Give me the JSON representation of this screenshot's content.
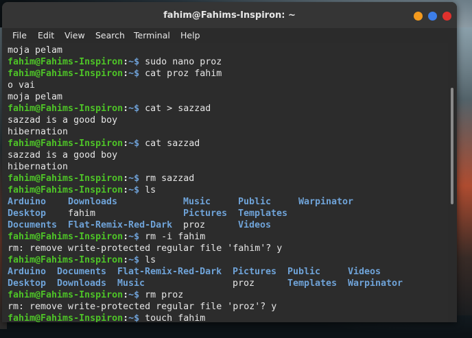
{
  "window": {
    "title": "fahim@Fahims-Inspiron: ~"
  },
  "menu": {
    "file": "File",
    "edit": "Edit",
    "view": "View",
    "search": "Search",
    "terminal": "Terminal",
    "help": "Help"
  },
  "prompt": {
    "user_host": "fahim@Fahims-Inspiron",
    "sep": ":",
    "path": "~$"
  },
  "lines": [
    {
      "kind": "text",
      "text": "moja pelam"
    },
    {
      "kind": "cmd",
      "text": " sudo nano proz"
    },
    {
      "kind": "cmd",
      "text": " cat proz fahim"
    },
    {
      "kind": "text",
      "text": "o vai"
    },
    {
      "kind": "text",
      "text": "moja pelam"
    },
    {
      "kind": "cmd",
      "text": " cat > sazzad"
    },
    {
      "kind": "text",
      "text": "sazzad is a good boy"
    },
    {
      "kind": "text",
      "text": "hibernation"
    },
    {
      "kind": "cmd",
      "text": " cat sazzad"
    },
    {
      "kind": "text",
      "text": "sazzad is a good boy"
    },
    {
      "kind": "text",
      "text": "hibernation"
    },
    {
      "kind": "cmd",
      "text": " rm sazzad"
    },
    {
      "kind": "cmd",
      "text": " ls"
    },
    {
      "kind": "ls",
      "cells": [
        {
          "text": "Arduino",
          "type": "dir",
          "col": 0
        },
        {
          "text": "Downloads",
          "type": "dir",
          "col": 11
        },
        {
          "text": "Music",
          "type": "dir",
          "col": 32
        },
        {
          "text": "Public",
          "type": "dir",
          "col": 42
        },
        {
          "text": "Warpinator",
          "type": "dir",
          "col": 53
        }
      ]
    },
    {
      "kind": "ls",
      "cells": [
        {
          "text": "Desktop",
          "type": "dir",
          "col": 0
        },
        {
          "text": "fahim",
          "type": "file",
          "col": 11
        },
        {
          "text": "Pictures",
          "type": "dir",
          "col": 32
        },
        {
          "text": "Templates",
          "type": "dir",
          "col": 42
        }
      ]
    },
    {
      "kind": "ls",
      "cells": [
        {
          "text": "Documents",
          "type": "dir",
          "col": 0
        },
        {
          "text": "Flat-Remix-Red-Dark",
          "type": "dir",
          "col": 11
        },
        {
          "text": "proz",
          "type": "file",
          "col": 32
        },
        {
          "text": "Videos",
          "type": "dir",
          "col": 42
        }
      ]
    },
    {
      "kind": "cmd",
      "text": " rm -i fahim"
    },
    {
      "kind": "text",
      "text": "rm: remove write-protected regular file 'fahim'? y"
    },
    {
      "kind": "cmd",
      "text": " ls"
    },
    {
      "kind": "ls",
      "cells": [
        {
          "text": "Arduino",
          "type": "dir",
          "col": 0
        },
        {
          "text": "Documents",
          "type": "dir",
          "col": 9
        },
        {
          "text": "Flat-Remix-Red-Dark",
          "type": "dir",
          "col": 20
        },
        {
          "text": "Pictures",
          "type": "dir",
          "col": 41
        },
        {
          "text": "Public",
          "type": "dir",
          "col": 51
        },
        {
          "text": "Videos",
          "type": "dir",
          "col": 62
        }
      ]
    },
    {
      "kind": "ls",
      "cells": [
        {
          "text": "Desktop",
          "type": "dir",
          "col": 0
        },
        {
          "text": "Downloads",
          "type": "dir",
          "col": 9
        },
        {
          "text": "Music",
          "type": "dir",
          "col": 20
        },
        {
          "text": "proz",
          "type": "file",
          "col": 41
        },
        {
          "text": "Templates",
          "type": "dir",
          "col": 51
        },
        {
          "text": "Warpinator",
          "type": "dir",
          "col": 62
        }
      ]
    },
    {
      "kind": "cmd",
      "text": " rm proz"
    },
    {
      "kind": "text",
      "text": "rm: remove write-protected regular file 'proz'? y"
    },
    {
      "kind": "cmd",
      "text": " touch fahim"
    }
  ]
}
